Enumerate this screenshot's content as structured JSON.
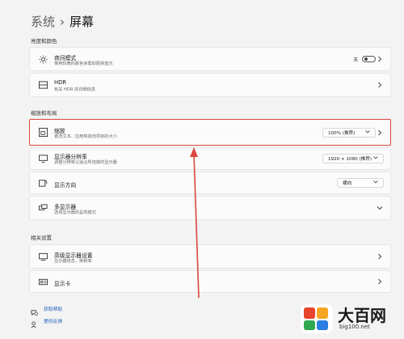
{
  "breadcrumb": {
    "parent": "系统",
    "separator": "›",
    "current": "屏幕"
  },
  "sections": {
    "brightness_color": "亮度和颜色",
    "scale_layout": "缩放和布局",
    "related": "相关设置"
  },
  "cards": {
    "night_light": {
      "title": "夜间模式",
      "subtitle": "使用较暖的颜色来帮助阻挡蓝光",
      "toggle_label": "关",
      "toggle_on": false
    },
    "hdr": {
      "title": "HDR",
      "subtitle": "有关 HDR 的详细信息"
    },
    "scale": {
      "title": "缩放",
      "subtitle": "更改文本、应用和其他项目的大小",
      "value": "100% (推荐)"
    },
    "resolution": {
      "title": "显示器分辨率",
      "subtitle": "调整分辨率以适合所连接的显示器",
      "value": "1920 × 1080 (推荐)"
    },
    "orientation": {
      "title": "显示方向",
      "value": "横向"
    },
    "multiple": {
      "title": "多显示器",
      "subtitle": "选择显示器的呈现模式"
    },
    "advanced": {
      "title": "高级显示器设置",
      "subtitle": "显示器信息，刷新率"
    },
    "gpu": {
      "title": "显示卡"
    }
  },
  "links": {
    "help": "获取帮助",
    "feedback": "提供反馈"
  },
  "watermark": {
    "brand": "大百网",
    "url": "big100.net"
  },
  "colors": {
    "highlight": "#d9473e",
    "arrow": "#d9473e",
    "link": "#1f5fbf"
  }
}
